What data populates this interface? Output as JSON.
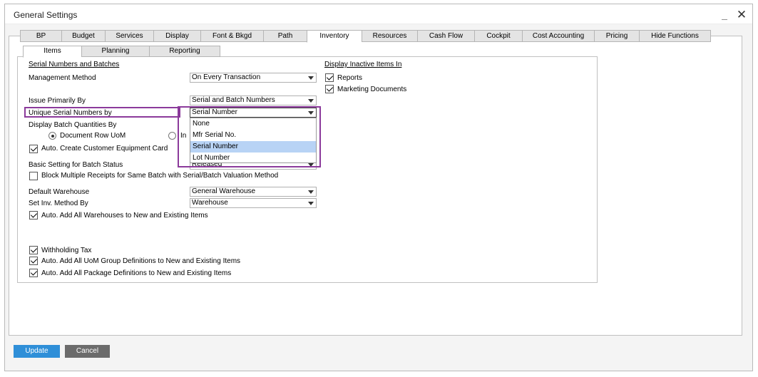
{
  "window": {
    "title": "General Settings",
    "minimize": "_",
    "close": "✕"
  },
  "tabs": [
    {
      "label": "BP",
      "active": false
    },
    {
      "label": "Budget",
      "active": false
    },
    {
      "label": "Services",
      "active": false
    },
    {
      "label": "Display",
      "active": false
    },
    {
      "label": "Font & Bkgd",
      "active": false
    },
    {
      "label": "Path",
      "active": false
    },
    {
      "label": "Inventory",
      "active": true
    },
    {
      "label": "Resources",
      "active": false
    },
    {
      "label": "Cash Flow",
      "active": false
    },
    {
      "label": "Cockpit",
      "active": false
    },
    {
      "label": "Cost Accounting",
      "active": false
    },
    {
      "label": "Pricing",
      "active": false
    },
    {
      "label": "Hide Functions",
      "active": false
    }
  ],
  "subtabs": [
    {
      "label": "Items",
      "active": true
    },
    {
      "label": "Planning",
      "active": false
    },
    {
      "label": "Reporting",
      "active": false
    }
  ],
  "serial": {
    "heading": "Serial Numbers and Batches",
    "management_method": {
      "label": "Management Method",
      "value": "On Every Transaction"
    },
    "issue_primarily": {
      "label": "Issue Primarily By",
      "value": "Serial and Batch Numbers"
    },
    "unique_serial": {
      "label": "Unique Serial Numbers by",
      "value": "Serial Number",
      "options": [
        "None",
        "Mfr Serial No.",
        "Serial Number",
        "Lot Number"
      ],
      "highlighted": "Serial Number"
    },
    "display_batch": {
      "label": "Display Batch Quantities By",
      "option1": "Document Row UoM",
      "option2": "In"
    },
    "auto_equipment": {
      "label": "Auto. Create Customer Equipment Card",
      "checked": true
    },
    "batch_status": {
      "label": "Basic Setting for Batch Status",
      "value": "Released"
    },
    "block_receipts": {
      "label": "Block Multiple Receipts for Same Batch with Serial/Batch Valuation Method",
      "checked": false
    }
  },
  "warehouse": {
    "default": {
      "label": "Default Warehouse",
      "value": "General Warehouse"
    },
    "inv_method": {
      "label": "Set Inv. Method By",
      "value": "Warehouse"
    },
    "auto_add": {
      "label": "Auto. Add All Warehouses to New and Existing Items",
      "checked": true
    }
  },
  "inactive": {
    "heading": "Display Inactive Items In",
    "reports": {
      "label": "Reports",
      "checked": true
    },
    "marketing": {
      "label": "Marketing Documents",
      "checked": true
    }
  },
  "bottom_checks": {
    "withholding": {
      "label": "Withholding Tax",
      "checked": true
    },
    "uom": {
      "label": "Auto. Add All UoM Group Definitions to New and Existing Items",
      "checked": true
    },
    "package": {
      "label": "Auto. Add All Package Definitions to New and Existing Items",
      "checked": true
    }
  },
  "buttons": {
    "update": "Update",
    "cancel": "Cancel"
  },
  "colors": {
    "highlight_border": "#8b3a9b",
    "update_button": "#2f8fd8",
    "cancel_button": "#6b6b6b",
    "selected_option": "#b8d3f5"
  }
}
